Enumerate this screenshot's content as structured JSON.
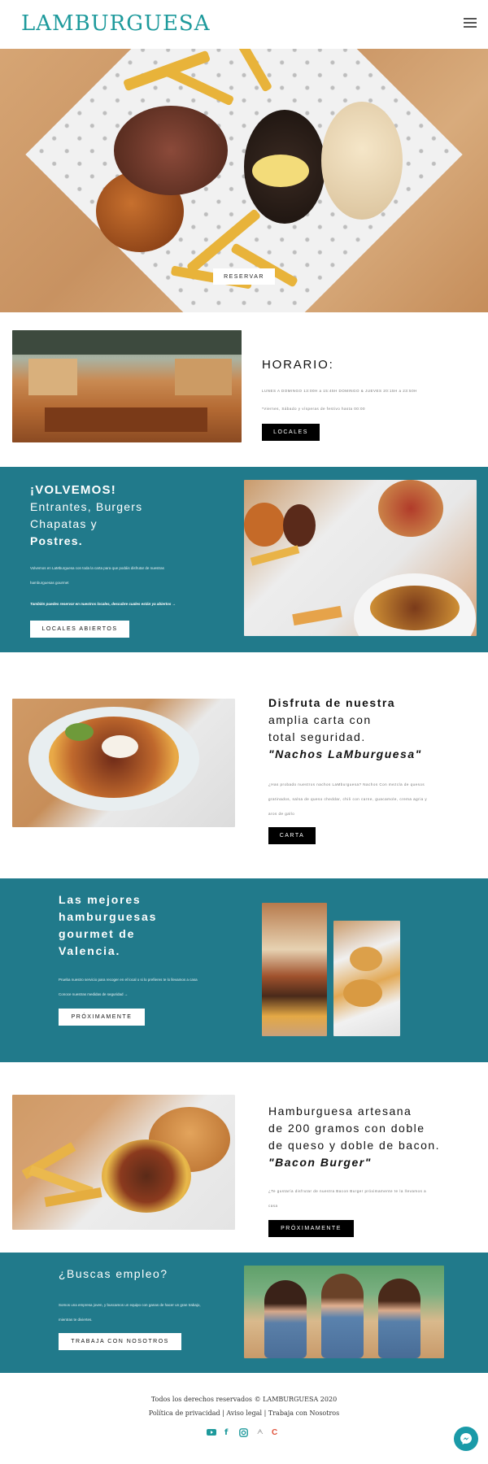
{
  "header": {
    "logo": "LAMBURGUESA",
    "menu_icon": "hamburger-menu-icon"
  },
  "hero": {
    "button": "RESERVAR"
  },
  "horario": {
    "title": "HORARIO:",
    "hours": "LUNES A DOMINGO 13:00H a 15:45H DOMINGO & JUEVES 20:15H a 23:50H",
    "note": "*Viernes, Sábado y vísperas de festivo hasta 00:00",
    "button": "LOCALES"
  },
  "volvemos": {
    "title_1": "¡VOLVEMOS!",
    "title_2": "Entrantes, Burgers",
    "title_3": "Chapatas y",
    "title_4": "Postres.",
    "text_1": "Volvemos en LaMburguesa con toda la carta para que podáis disfrutar de nuestras",
    "text_2": "hamburguesas gourmet",
    "text_3": "También puedes reservar en nuestros locales, descubre cuales están ya abiertos →",
    "button": "LOCALES ABIERTOS"
  },
  "nachos": {
    "title_1": "Disfruta de nuestra",
    "title_2": "amplia carta con",
    "title_3": "total seguridad.",
    "title_4": "\"Nachos LaMburguesa\"",
    "text_1": "¿Has probado nuestros nachos LaMburguesa? Nachos Con mezcla de quesos",
    "text_2": "gratinados, salsa de queso cheddar, chili con carne, guacamole, crema agria y",
    "text_3": "aros de gallo",
    "button": "CARTA"
  },
  "mejores": {
    "title_1": "Las mejores",
    "title_2": "hamburguesas",
    "title_3": "gourmet de",
    "title_4": "Valencia.",
    "text_1": "Prueba nuestro servicio para recoger en el local o si lo prefieres te lo llevamos a casa",
    "text_2": "Conoce nuestras medidas de seguridad →",
    "button": "PRÓXIMAMENTE"
  },
  "bacon": {
    "title_1": "Hamburguesa artesana",
    "title_2": "de 200 gramos con doble",
    "title_3": "de queso y doble de bacon.",
    "title_4": "\"Bacon Burger\"",
    "text_1": "¿Te gustaría disfrutar de nuestra Bacon Burger próximamente te la llevamos a",
    "text_2": "casa",
    "button": "PRÓXIMAMENTE"
  },
  "empleo": {
    "title": "¿Buscas empleo?",
    "text_1": "Somos una empresa joven, y buscamos un equipo con ganas de hacer un gran trabajo,",
    "text_2": "mientras te diviertes.",
    "button": "TRABAJA CON NOSOTROS"
  },
  "footer": {
    "copyright": "Todos los derechos reservados © LAMBURGUESA 2020",
    "links": "Política de privacidad | Aviso legal | Trabaja con Nosotros",
    "icons": [
      "youtube-icon",
      "facebook-icon",
      "instagram-icon",
      "tripadvisor-icon",
      "thefork-icon"
    ]
  },
  "colors": {
    "teal": "#217a8b",
    "logo": "#1e9a9c"
  }
}
